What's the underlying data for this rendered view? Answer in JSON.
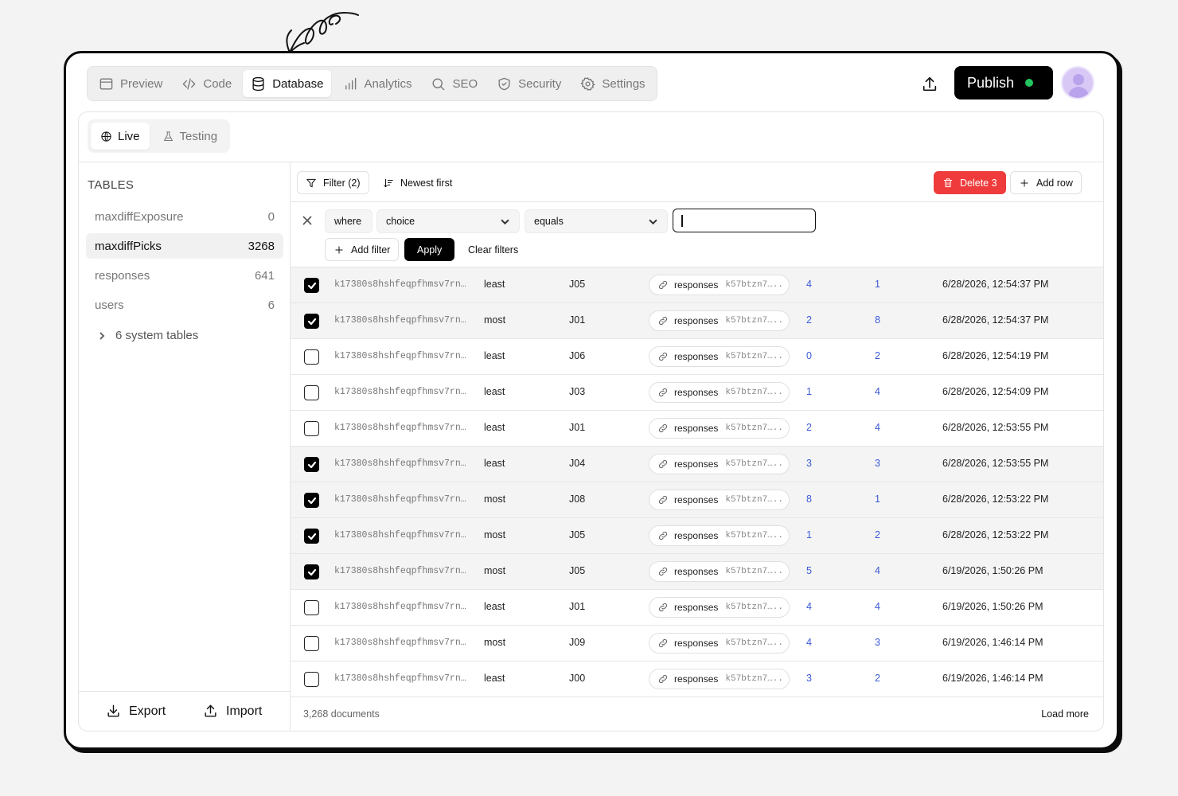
{
  "nav": {
    "tabs": [
      {
        "label": "Preview",
        "icon": "window-icon"
      },
      {
        "label": "Code",
        "icon": "code-icon"
      },
      {
        "label": "Database",
        "icon": "database-icon",
        "active": true
      },
      {
        "label": "Analytics",
        "icon": "bar-chart-icon"
      },
      {
        "label": "SEO",
        "icon": "search-icon"
      },
      {
        "label": "Security",
        "icon": "shield-icon"
      },
      {
        "label": "Settings",
        "icon": "gear-icon"
      }
    ],
    "publish_label": "Publish",
    "publish_status_color": "#22c55e"
  },
  "env": {
    "live_label": "Live",
    "testing_label": "Testing"
  },
  "sidebar": {
    "heading": "TABLES",
    "tables": [
      {
        "name": "maxdiffExposure",
        "count": "0"
      },
      {
        "name": "maxdiffPicks",
        "count": "3268",
        "active": true
      },
      {
        "name": "responses",
        "count": "641"
      },
      {
        "name": "users",
        "count": "6"
      }
    ],
    "system_tables_label": "6 system tables",
    "export_label": "Export",
    "import_label": "Import"
  },
  "toolbar": {
    "filter_label": "Filter (2)",
    "sort_label": "Newest first",
    "delete_label": "Delete 3",
    "add_row_label": "Add row",
    "delete_color": "#ef3b3b"
  },
  "filter": {
    "where_label": "where",
    "field_value": "choice",
    "operator_value": "equals",
    "value_input": "",
    "add_filter_label": "Add filter",
    "apply_label": "Apply",
    "clear_label": "Clear filters"
  },
  "rows": [
    {
      "checked": true,
      "id": "k17380s8hshfeqpfhmsv7rn…",
      "choice": "least",
      "job": "J05",
      "ref_table": "responses",
      "ref_id": "k57btzn7…..",
      "n1": "4",
      "n2": "1",
      "date": "6/28/2026, 12:54:37 PM"
    },
    {
      "checked": true,
      "id": "k17380s8hshfeqpfhmsv7rn…",
      "choice": "most",
      "job": "J01",
      "ref_table": "responses",
      "ref_id": "k57btzn7…..",
      "n1": "2",
      "n2": "8",
      "date": "6/28/2026, 12:54:37 PM"
    },
    {
      "checked": false,
      "id": "k17380s8hshfeqpfhmsv7rn…",
      "choice": "least",
      "job": "J06",
      "ref_table": "responses",
      "ref_id": "k57btzn7…..",
      "n1": "0",
      "n2": "2",
      "date": "6/28/2026, 12:54:19 PM"
    },
    {
      "checked": false,
      "id": "k17380s8hshfeqpfhmsv7rn…",
      "choice": "least",
      "job": "J03",
      "ref_table": "responses",
      "ref_id": "k57btzn7…..",
      "n1": "1",
      "n2": "4",
      "date": "6/28/2026, 12:54:09 PM"
    },
    {
      "checked": false,
      "id": "k17380s8hshfeqpfhmsv7rn…",
      "choice": "least",
      "job": "J01",
      "ref_table": "responses",
      "ref_id": "k57btzn7…..",
      "n1": "2",
      "n2": "4",
      "date": "6/28/2026, 12:53:55 PM"
    },
    {
      "checked": true,
      "id": "k17380s8hshfeqpfhmsv7rn…",
      "choice": "least",
      "job": "J04",
      "ref_table": "responses",
      "ref_id": "k57btzn7…..",
      "n1": "3",
      "n2": "3",
      "date": "6/28/2026, 12:53:55 PM"
    },
    {
      "checked": true,
      "id": "k17380s8hshfeqpfhmsv7rn…",
      "choice": "most",
      "job": "J08",
      "ref_table": "responses",
      "ref_id": "k57btzn7…..",
      "n1": "8",
      "n2": "1",
      "date": "6/28/2026, 12:53:22 PM"
    },
    {
      "checked": true,
      "id": "k17380s8hshfeqpfhmsv7rn…",
      "choice": "most",
      "job": "J05",
      "ref_table": "responses",
      "ref_id": "k57btzn7…..",
      "n1": "1",
      "n2": "2",
      "date": "6/28/2026, 12:53:22 PM"
    },
    {
      "checked": true,
      "id": "k17380s8hshfeqpfhmsv7rn…",
      "choice": "most",
      "job": "J05",
      "ref_table": "responses",
      "ref_id": "k57btzn7…..",
      "n1": "5",
      "n2": "4",
      "date": "6/19/2026, 1:50:26 PM"
    },
    {
      "checked": false,
      "id": "k17380s8hshfeqpfhmsv7rn…",
      "choice": "least",
      "job": "J01",
      "ref_table": "responses",
      "ref_id": "k57btzn7…..",
      "n1": "4",
      "n2": "4",
      "date": "6/19/2026, 1:50:26 PM"
    },
    {
      "checked": false,
      "id": "k17380s8hshfeqpfhmsv7rn…",
      "choice": "most",
      "job": "J09",
      "ref_table": "responses",
      "ref_id": "k57btzn7…..",
      "n1": "4",
      "n2": "3",
      "date": "6/19/2026, 1:46:14 PM"
    },
    {
      "checked": false,
      "id": "k17380s8hshfeqpfhmsv7rn…",
      "choice": "least",
      "job": "J00",
      "ref_table": "responses",
      "ref_id": "k57btzn7…..",
      "n1": "3",
      "n2": "2",
      "date": "6/19/2026, 1:46:14 PM"
    }
  ],
  "footer": {
    "count_label": "3,268 documents",
    "load_more_label": "Load more"
  }
}
